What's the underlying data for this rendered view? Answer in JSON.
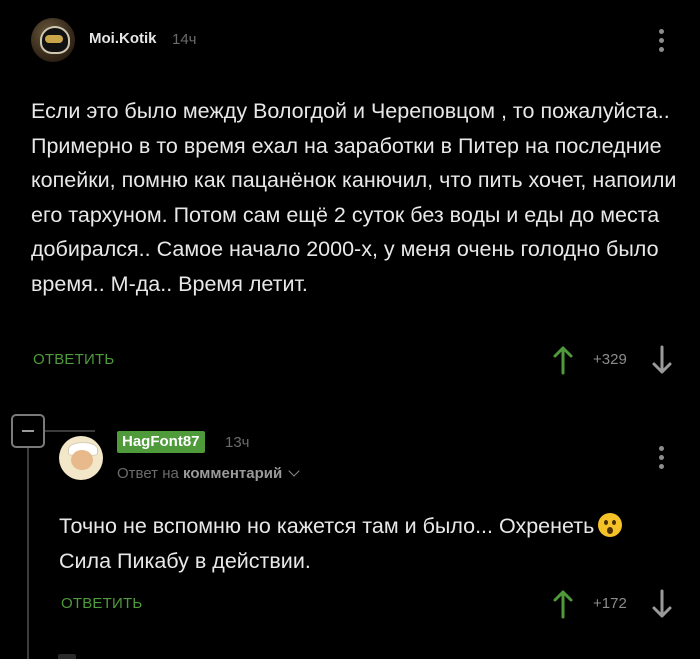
{
  "colors": {
    "background": "#000000",
    "accent_green": "#4f9a3b",
    "text": "#e8e8e8",
    "muted": "#6b6b6b"
  },
  "comment_1": {
    "author": "Moi.Kotik",
    "time": "14ч",
    "avatar_icon": "motorcycle-helmet-avatar",
    "text": "Если это было между Вологдой и Череповцом , то пожалуйста.. Примерно в то время ехал на заработки в Питер на последние копейки, помню как пацанёнок канючил, что пить хочет, напоили его тархуном. Потом сам ещё 2 суток без воды и еды до места добирался.. Самое начало 2000-х, у меня очень голодно было время.. М-да.. Время летит.",
    "reply_label": "ОТВЕТИТЬ",
    "score": "+329"
  },
  "comment_2": {
    "author": "HagFont87",
    "time": "13ч",
    "avatar_icon": "chef-cartoon-avatar",
    "reply_to_prefix": "Ответ на",
    "reply_to_target": "комментарий",
    "text": "Точно не вспомню но кажется там и было... Охренеть",
    "text_line2": "Сила Пикабу в действии.",
    "emoji": "astonished-face",
    "reply_label": "ОТВЕТИТЬ",
    "score": "+172"
  }
}
